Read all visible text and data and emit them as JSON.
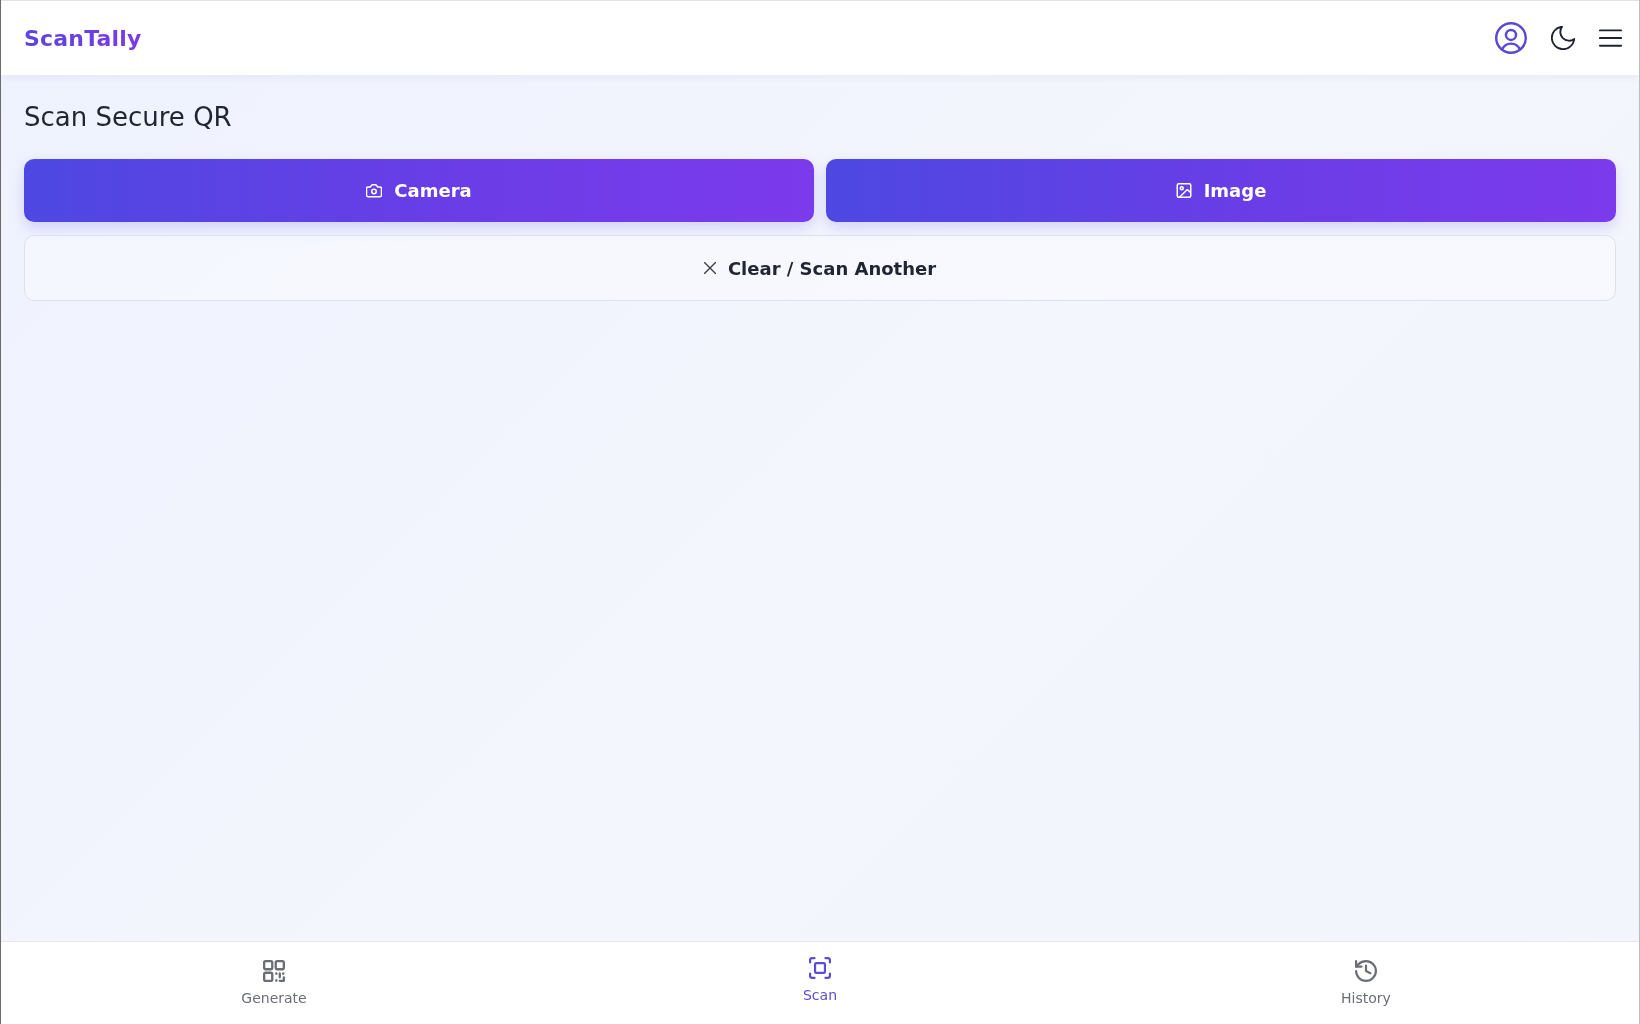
{
  "app_bar": {
    "logo": "ScanTally"
  },
  "page": {
    "title": "Scan Secure QR",
    "sources": [
      {
        "label": "Camera",
        "kind": "camera"
      },
      {
        "label": "Image",
        "kind": "image"
      }
    ],
    "clear_button": {
      "label": "Clear / Scan Another"
    }
  },
  "bottom_nav": [
    {
      "label": "Generate",
      "kind": "generate",
      "selected": false
    },
    {
      "label": "Scan",
      "kind": "scan",
      "selected": true
    },
    {
      "label": "History",
      "kind": "history",
      "selected": false
    }
  ]
}
